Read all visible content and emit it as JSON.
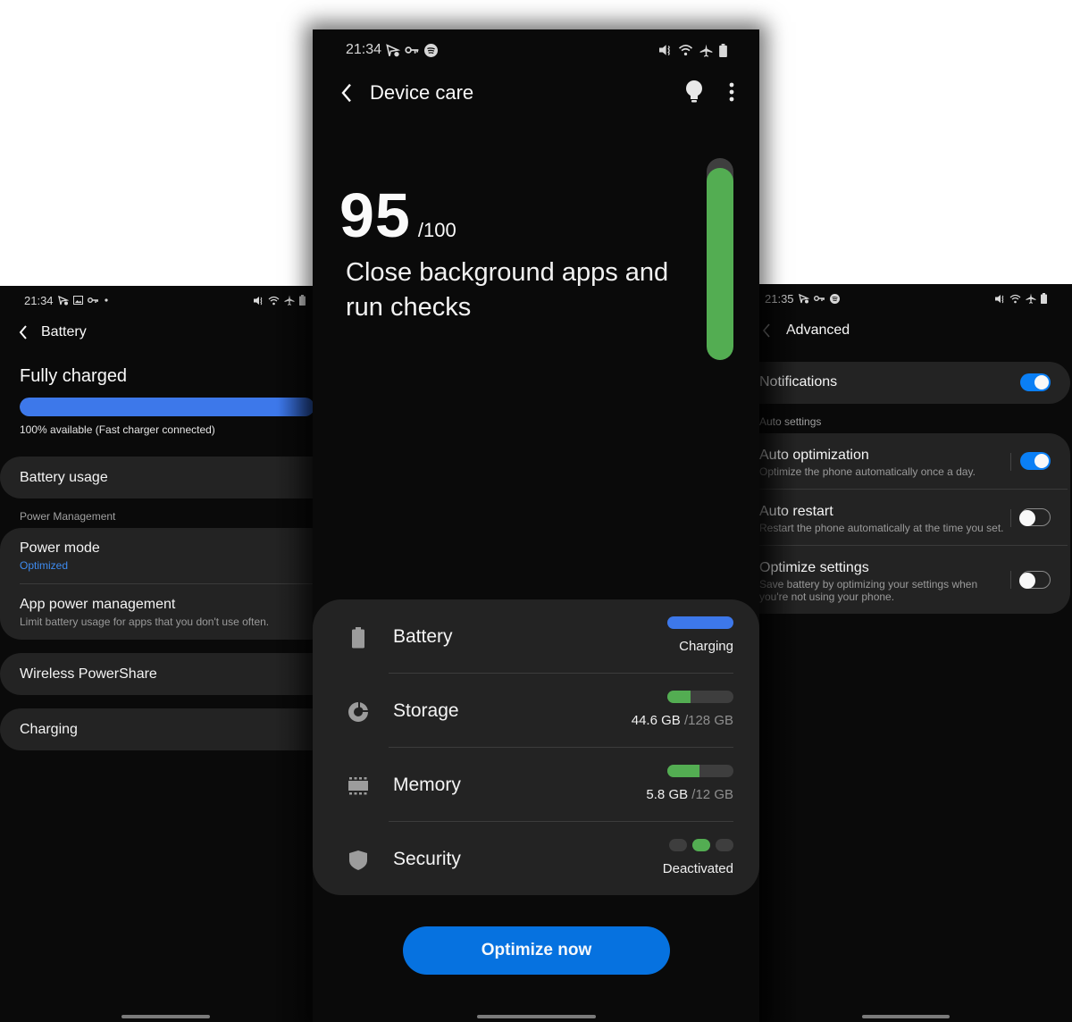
{
  "left_screen": {
    "status_bar": {
      "time": "21:34",
      "left_icons": [
        "nfc-check-icon",
        "image-icon",
        "vpn-key-icon",
        "dot-icon"
      ],
      "right_icons": [
        "mute-icon",
        "wifi-icon",
        "airplane-icon",
        "battery-icon"
      ]
    },
    "title": "Battery",
    "headline": "Fully charged",
    "charge_level_percent": 100,
    "charge_caption": "100% available (Fast charger connected)",
    "items": {
      "battery_usage": "Battery usage",
      "power_management_label": "Power Management",
      "power_mode": {
        "title": "Power mode",
        "value": "Optimized"
      },
      "app_power_management": {
        "title": "App power management",
        "subtitle": "Limit battery usage for apps that you don't use often."
      },
      "wireless_powershare": "Wireless PowerShare",
      "charging": "Charging"
    }
  },
  "center_screen": {
    "status_bar": {
      "time": "21:34",
      "left_icons": [
        "nfc-check-icon",
        "vpn-key-icon",
        "spotify-icon"
      ],
      "right_icons": [
        "mute-icon",
        "wifi-icon",
        "airplane-icon",
        "battery-icon"
      ]
    },
    "title": "Device care",
    "actions": [
      "lightbulb-icon",
      "more-options-icon"
    ],
    "score": "95",
    "score_max": "/100",
    "score_fraction": 0.95,
    "message": "Close background apps and run checks",
    "categories": [
      {
        "label": "Battery",
        "icon": "battery-icon",
        "status": "Charging",
        "fill_fraction": 1.0,
        "fill_color": "#3d78ea"
      },
      {
        "label": "Storage",
        "icon": "storage-pie-icon",
        "used": "44.6 GB",
        "total": "/128 GB",
        "fill_fraction": 0.35,
        "fill_color": "#53ad52"
      },
      {
        "label": "Memory",
        "icon": "memory-chip-icon",
        "used": "5.8 GB",
        "total": "/12 GB",
        "fill_fraction": 0.48,
        "fill_color": "#53ad52"
      },
      {
        "label": "Security",
        "icon": "shield-icon",
        "status": "Deactivated",
        "active_dot_index": 1,
        "dot_count": 3
      }
    ],
    "optimize_button": "Optimize now"
  },
  "right_screen": {
    "status_bar": {
      "time": "21:35",
      "left_icons": [
        "nfc-check-icon",
        "vpn-key-icon",
        "spotify-icon"
      ],
      "right_icons": [
        "mute-icon",
        "wifi-icon",
        "airplane-icon",
        "battery-icon"
      ]
    },
    "title": "Advanced",
    "notifications": {
      "label": "Notifications",
      "enabled": true
    },
    "auto_settings_label": "Auto settings",
    "settings": [
      {
        "title": "Auto optimization",
        "subtitle": "Optimize the phone automatically once a day.",
        "enabled": true
      },
      {
        "title": "Auto restart",
        "subtitle": "Restart the phone automatically at the time you set.",
        "enabled": false
      },
      {
        "title": "Optimize settings",
        "subtitle": "Save battery by optimizing your settings when you're not using your phone.",
        "enabled": false
      }
    ]
  },
  "colors": {
    "accent_blue": "#0672e0",
    "toggle_blue": "#0a7ff5",
    "green": "#53ad52",
    "battery_blue": "#3d78ea",
    "link_blue": "#3e8bf0"
  }
}
